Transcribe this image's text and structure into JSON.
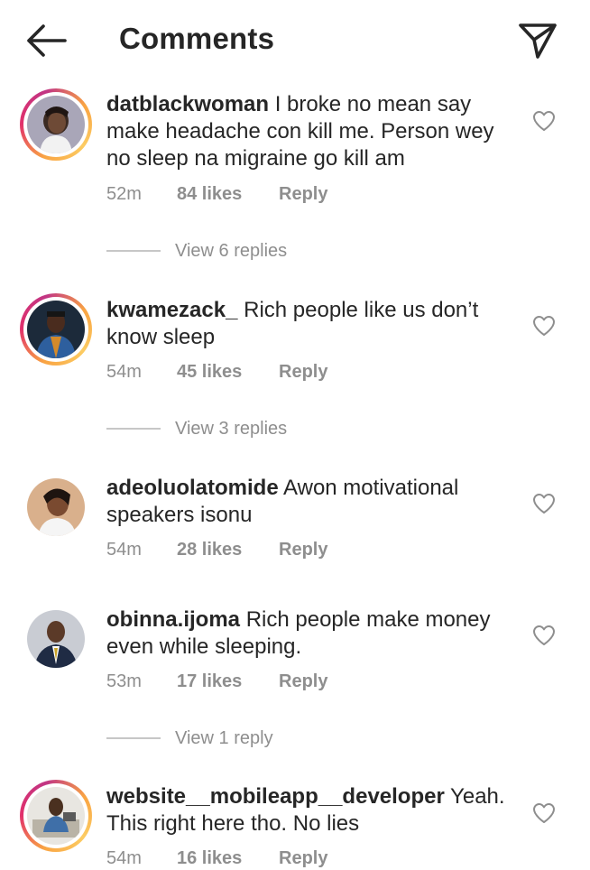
{
  "header": {
    "title": "Comments",
    "back_icon": "arrow-left-icon",
    "send_icon": "paper-plane-icon"
  },
  "comments": [
    {
      "username": "datblackwoman",
      "text": "I broke no mean say make headache con kill me. Person wey no sleep na migraine go kill am",
      "time": "52m",
      "likes": "84 likes",
      "reply": "Reply",
      "view_replies": "View 6 replies",
      "story_ring": true
    },
    {
      "username": "kwamezack_",
      "text": "Rich people like us don’t know sleep",
      "time": "54m",
      "likes": "45 likes",
      "reply": "Reply",
      "view_replies": "View 3 replies",
      "story_ring": true
    },
    {
      "username": "adeoluolatomide",
      "text": "Awon motivational speakers isonu",
      "time": "54m",
      "likes": "28 likes",
      "reply": "Reply",
      "view_replies": "",
      "story_ring": false
    },
    {
      "username": "obinna.ijoma",
      "text": "Rich people make money even while sleeping.",
      "time": "53m",
      "likes": "17 likes",
      "reply": "Reply",
      "view_replies": "View 1 reply",
      "story_ring": false
    },
    {
      "username": "website__mobileapp__developer",
      "text": "Yeah. This right here tho. No lies",
      "time": "54m",
      "likes": "16 likes",
      "reply": "Reply",
      "view_replies": "",
      "story_ring": true
    }
  ],
  "colors": {
    "text": "#262626",
    "secondary": "#8e8e8e",
    "divider": "#c7c7c7",
    "story_ring_start": "#f9a443",
    "story_ring_end": "#e1306c"
  }
}
